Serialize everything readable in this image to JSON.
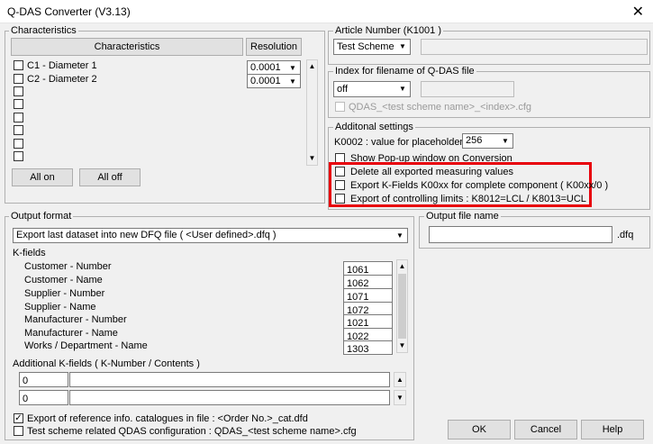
{
  "window": {
    "title": "Q-DAS Converter  (V3.13)",
    "close_glyph": "✕"
  },
  "characteristics": {
    "group_label": "Characteristics",
    "header_label": "Characteristics",
    "resolution_header": "Resolution",
    "rows": [
      {
        "label": "C1 - Diameter 1",
        "resolution": "0.0001"
      },
      {
        "label": "C2 - Diameter 2",
        "resolution": "0.0001"
      },
      {
        "label": ""
      },
      {
        "label": ""
      },
      {
        "label": ""
      },
      {
        "label": ""
      },
      {
        "label": ""
      },
      {
        "label": ""
      }
    ],
    "all_on": "All on",
    "all_off": "All off"
  },
  "article": {
    "group_label": "Article Number  (K1001 )",
    "select": "Test Scheme",
    "value": ""
  },
  "index": {
    "group_label": "Index for filename of Q-DAS file",
    "select": "off",
    "value": "",
    "checkbox_label": "QDAS_<test scheme name>_<index>.cfg"
  },
  "additional": {
    "group_label": "Additonal settings",
    "k0002_label": "K0002 : value for placeholder",
    "k0002_value": "256",
    "popup_label": "Show Pop-up window on Conversion",
    "delete_label": "Delete all exported measuring values",
    "export_k_label": "Export K-Fields K00xx for complete component ( K00xx/0 )",
    "export_limits_label": "Export of controlling limits :    K8012=LCL / K8013=UCL",
    "highlight_color": "#e8000b"
  },
  "output_format": {
    "group_label": "Output format",
    "select": "Export last dataset into new DFQ file ( <User defined>.dfq )",
    "kfields_label": "K-fields",
    "kfields": [
      {
        "label": "Customer - Number",
        "value": "1061"
      },
      {
        "label": "Customer - Name",
        "value": "1062"
      },
      {
        "label": "Supplier - Number",
        "value": "1071"
      },
      {
        "label": "Supplier - Name",
        "value": "1072"
      },
      {
        "label": "Manufacturer - Number",
        "value": "1021"
      },
      {
        "label": "Manufacturer - Name",
        "value": "1022"
      },
      {
        "label": "Works / Department - Name",
        "value": "1303"
      }
    ],
    "additional_label": "Additional K-fields ( K-Number / Contents )",
    "additional_rows": [
      {
        "num": "0",
        "content": ""
      },
      {
        "num": "0",
        "content": ""
      }
    ],
    "export_ref_label": "Export of reference info. catalogues in file :   <Order No.>_cat.dfd",
    "test_scheme_label": "Test scheme related QDAS configuration : QDAS_<test scheme name>.cfg"
  },
  "output_file": {
    "group_label": "Output file name",
    "value": "",
    "ext": ".dfq"
  },
  "buttons": {
    "ok": "OK",
    "cancel": "Cancel",
    "help": "Help"
  }
}
